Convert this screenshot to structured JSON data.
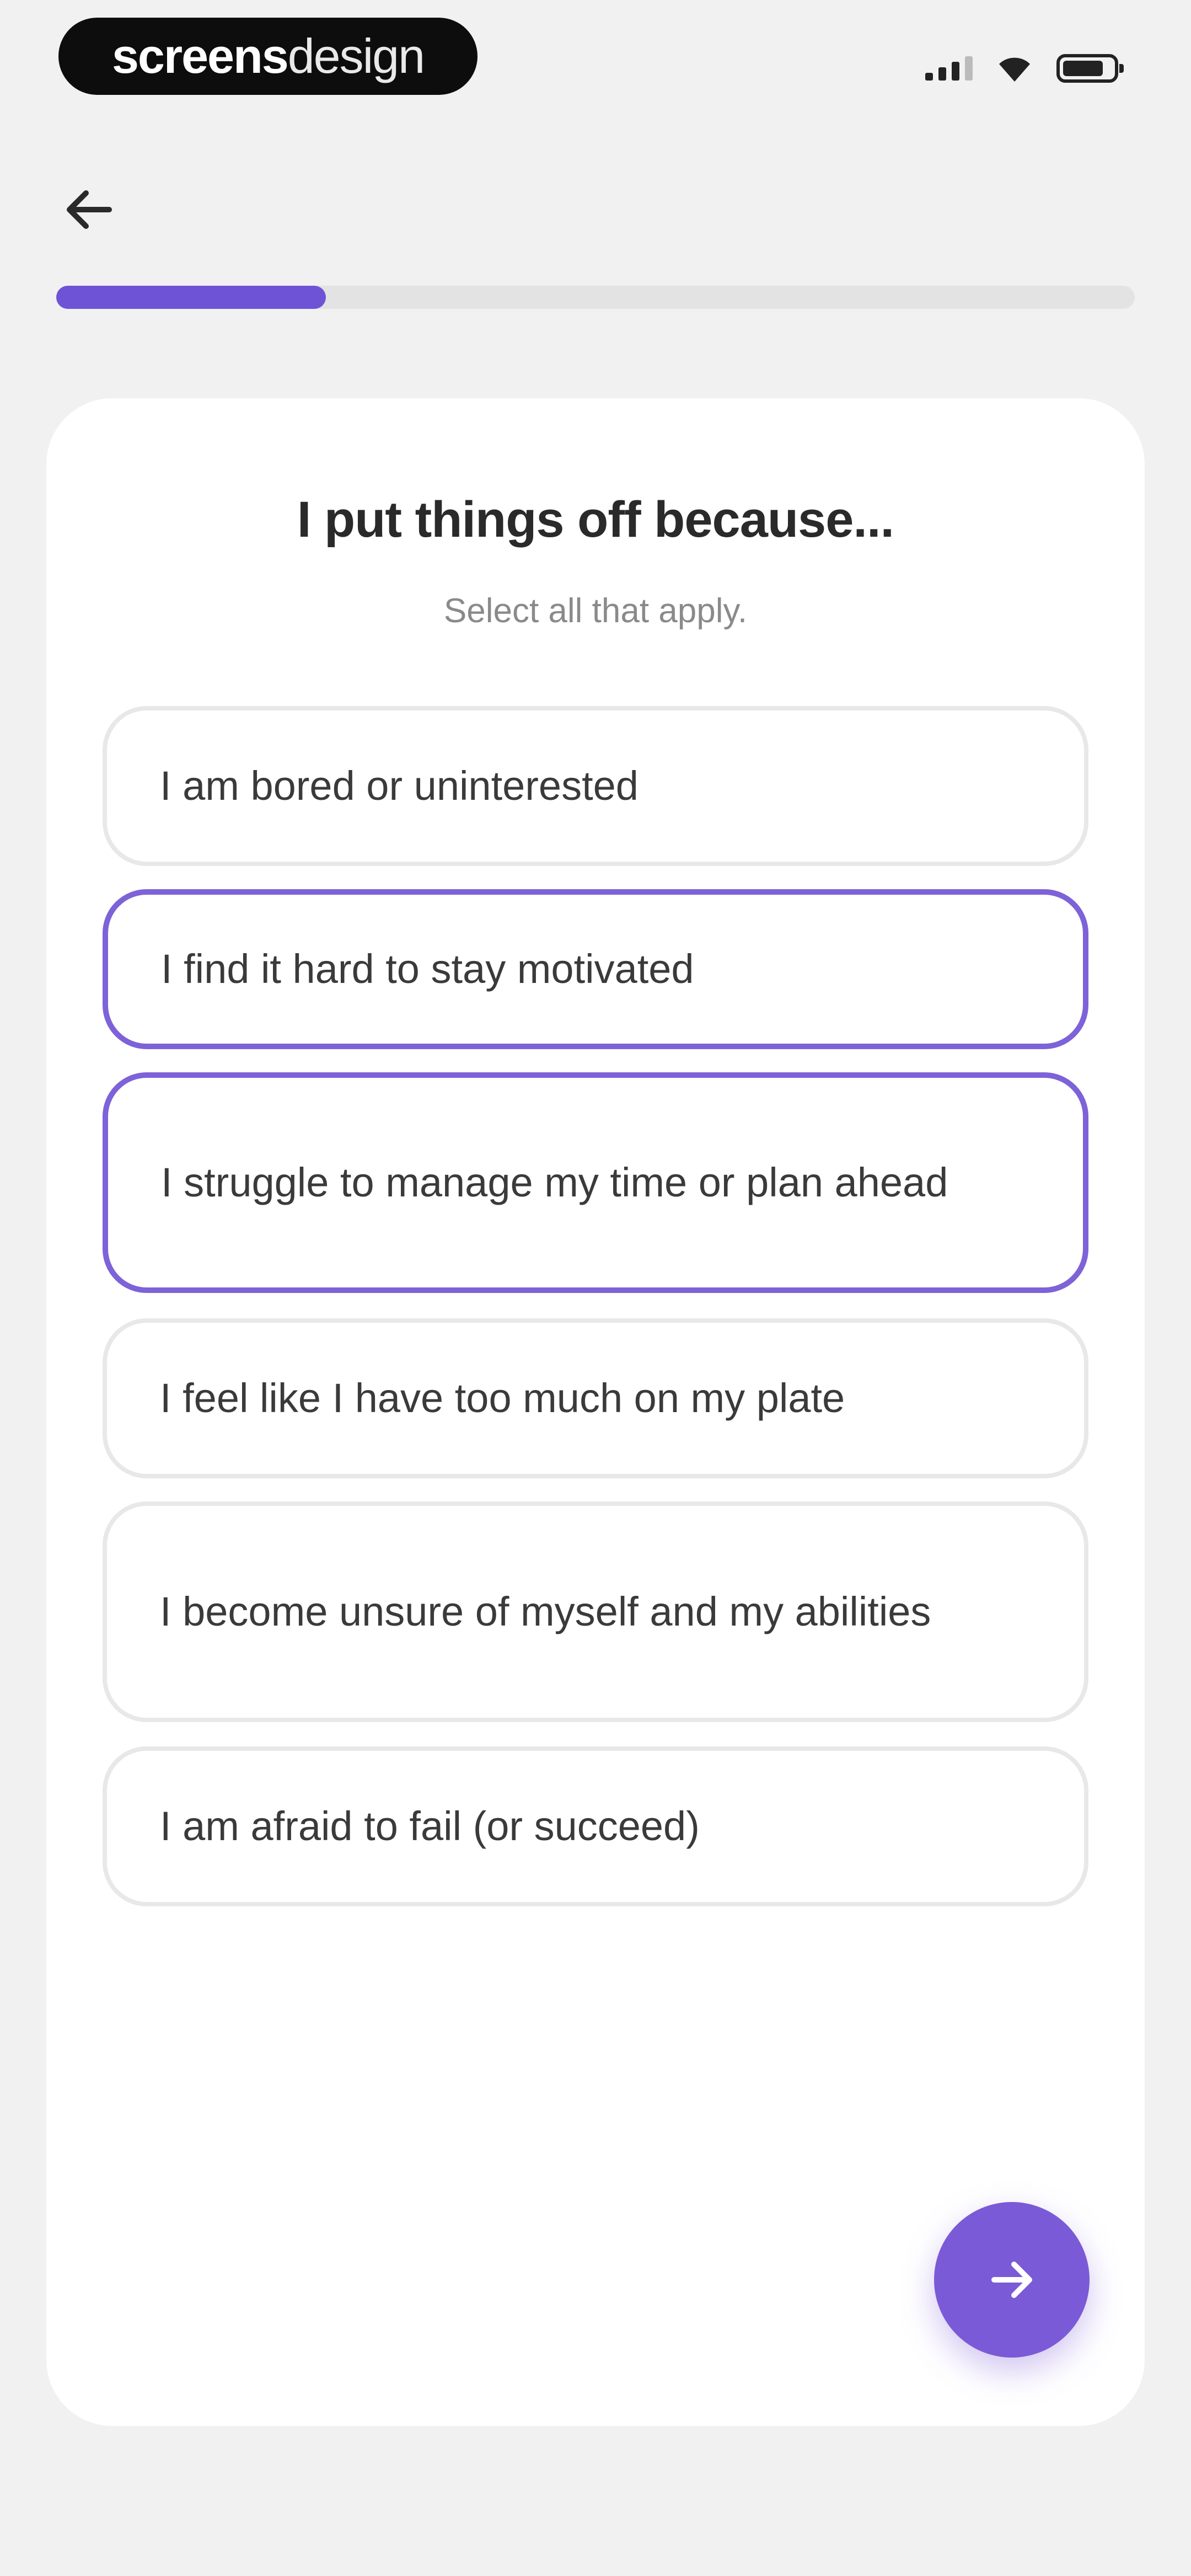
{
  "status_bar": {
    "brand_bold": "screens",
    "brand_light": "design",
    "icons": [
      "cellular-signal-icon",
      "wifi-icon",
      "battery-icon"
    ]
  },
  "nav": {
    "back_icon": "arrow-left-icon"
  },
  "progress": {
    "fraction": 0.25,
    "color": "#6f53d6",
    "track_color": "#e3e3e3"
  },
  "question": {
    "title": "I put things off because...",
    "subtitle": "Select all that apply."
  },
  "options": [
    {
      "label": "I am bored or uninterested",
      "selected": false
    },
    {
      "label": "I find it hard to stay motivated",
      "selected": true
    },
    {
      "label": "I struggle to manage my time or plan ahead",
      "selected": true
    },
    {
      "label": "I feel like I have too much on my plate",
      "selected": false
    },
    {
      "label": "I become unsure of myself and my abilities",
      "selected": false
    },
    {
      "label": "I am afraid to fail (or succeed)",
      "selected": false
    }
  ],
  "next_button": {
    "icon": "arrow-right-icon",
    "color": "#7a5ad6"
  },
  "colors": {
    "accent": "#7a5ad6",
    "background": "#f1f1f1",
    "card": "#ffffff"
  }
}
